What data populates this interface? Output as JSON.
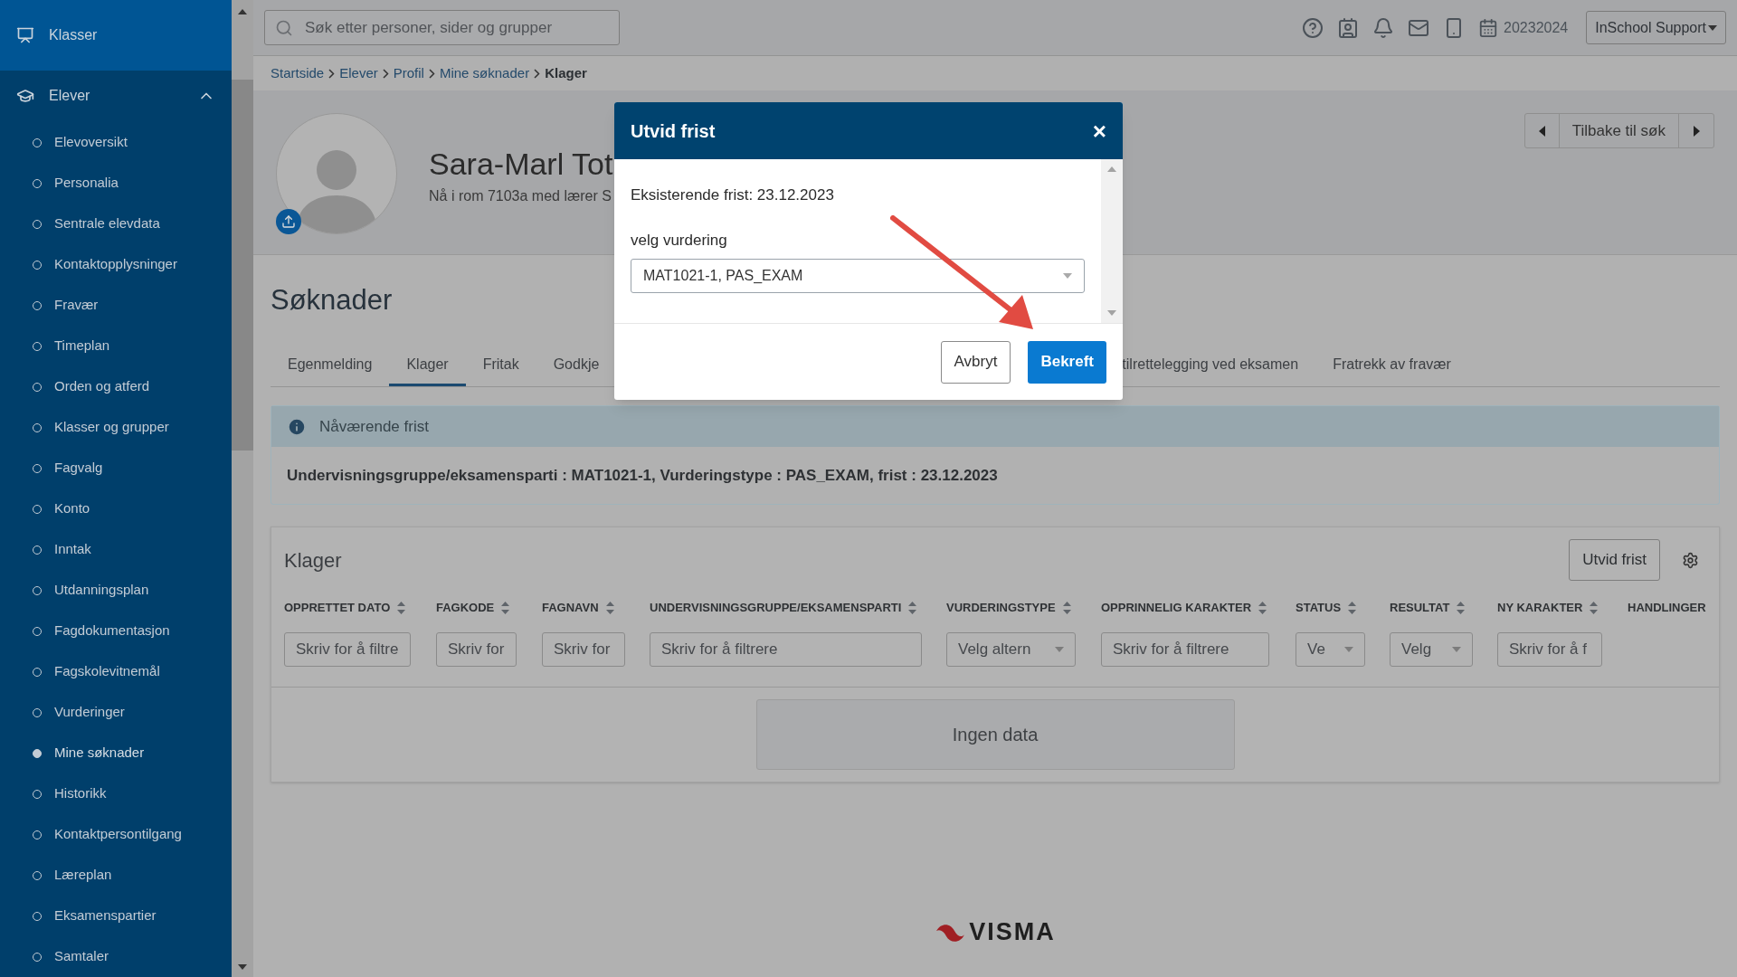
{
  "sidebar": {
    "sections": [
      {
        "label": "Klasser",
        "kind": "link"
      },
      {
        "label": "Elever",
        "kind": "group",
        "expanded": true
      }
    ],
    "items": [
      {
        "label": "Elevoversikt",
        "selected": false
      },
      {
        "label": "Personalia",
        "selected": false
      },
      {
        "label": "Sentrale elevdata",
        "selected": false
      },
      {
        "label": "Kontaktopplysninger",
        "selected": false
      },
      {
        "label": "Fravær",
        "selected": false
      },
      {
        "label": "Timeplan",
        "selected": false
      },
      {
        "label": "Orden og atferd",
        "selected": false
      },
      {
        "label": "Klasser og grupper",
        "selected": false
      },
      {
        "label": "Fagvalg",
        "selected": false
      },
      {
        "label": "Konto",
        "selected": false
      },
      {
        "label": "Inntak",
        "selected": false
      },
      {
        "label": "Utdanningsplan",
        "selected": false
      },
      {
        "label": "Fagdokumentasjon",
        "selected": false
      },
      {
        "label": "Fagskolevitnemål",
        "selected": false
      },
      {
        "label": "Vurderinger",
        "selected": false
      },
      {
        "label": "Mine søknader",
        "selected": true
      },
      {
        "label": "Historikk",
        "selected": false
      },
      {
        "label": "Kontaktpersontilgang",
        "selected": false
      },
      {
        "label": "Læreplan",
        "selected": false
      },
      {
        "label": "Eksamenspartier",
        "selected": false
      },
      {
        "label": "Samtaler",
        "selected": false
      }
    ]
  },
  "topbar": {
    "search": {
      "placeholder": "Søk etter personer, sider og grupper"
    },
    "school_year": "20232024",
    "user": "InSchool Support"
  },
  "breadcrumb": [
    {
      "label": "Startside",
      "current": false
    },
    {
      "label": "Elever",
      "current": false
    },
    {
      "label": "Profil",
      "current": false
    },
    {
      "label": "Mine søknader",
      "current": false
    },
    {
      "label": "Klager",
      "current": true
    }
  ],
  "profile": {
    "name": "Sara-Marl Tot",
    "subtitle": "Nå i rom 7103a med lærer S",
    "back": "Tilbake til søk"
  },
  "page_title": "Søknader",
  "tabs": [
    {
      "label": "Egenmelding",
      "selected": false
    },
    {
      "label": "Klager",
      "selected": true
    },
    {
      "label": "Fritak",
      "selected": false
    },
    {
      "label": "Godkje",
      "selected": false
    },
    {
      "label": "tilrettelegging ved eksamen",
      "selected": false
    },
    {
      "label": "Fratrekk av fravær",
      "selected": false
    }
  ],
  "info": {
    "title": "Nåværende frist",
    "text": "Undervisningsgruppe/eksamensparti : MAT1021-1, Vurderingstype : PAS_EXAM, frist : 23.12.2023"
  },
  "table": {
    "title": "Klager",
    "action": "Utvid frist",
    "columns": [
      {
        "label": "OPPRETTET DATO",
        "sortable": true,
        "filter": {
          "kind": "text",
          "placeholder": "Skriv for å filtre"
        }
      },
      {
        "label": "FAGKODE",
        "sortable": true,
        "filter": {
          "kind": "text",
          "placeholder": "Skriv for"
        }
      },
      {
        "label": "FAGNAVN",
        "sortable": true,
        "filter": {
          "kind": "text",
          "placeholder": "Skriv for"
        }
      },
      {
        "label": "UNDERVISNINGSGRUPPE/EKSAMENSPARTI",
        "sortable": true,
        "filter": {
          "kind": "text",
          "placeholder": "Skriv for å filtrere"
        }
      },
      {
        "label": "VURDERINGSTYPE",
        "sortable": true,
        "filter": {
          "kind": "select",
          "placeholder": "Velg altern"
        }
      },
      {
        "label": "OPPRINNELIG KARAKTER",
        "sortable": true,
        "filter": {
          "kind": "text",
          "placeholder": "Skriv for å filtrere"
        }
      },
      {
        "label": "STATUS",
        "sortable": true,
        "filter": {
          "kind": "select",
          "placeholder": "Ve"
        }
      },
      {
        "label": "RESULTAT",
        "sortable": true,
        "filter": {
          "kind": "select",
          "placeholder": "Velg"
        }
      },
      {
        "label": "NY KARAKTER",
        "sortable": true,
        "filter": {
          "kind": "text",
          "placeholder": "Skriv for å f"
        }
      },
      {
        "label": "HANDLINGER",
        "sortable": false,
        "filter": {
          "kind": "none"
        }
      }
    ],
    "empty": "Ingen data"
  },
  "footer_logo": "VISMA",
  "dialog": {
    "title": "Utvid frist",
    "close": "×",
    "existing": "Eksisterende frist: 23.12.2023",
    "select_label": "velg vurdering",
    "select_value": "MAT1021-1, PAS_EXAM",
    "cancel": "Avbryt",
    "confirm": "Bekreft"
  }
}
